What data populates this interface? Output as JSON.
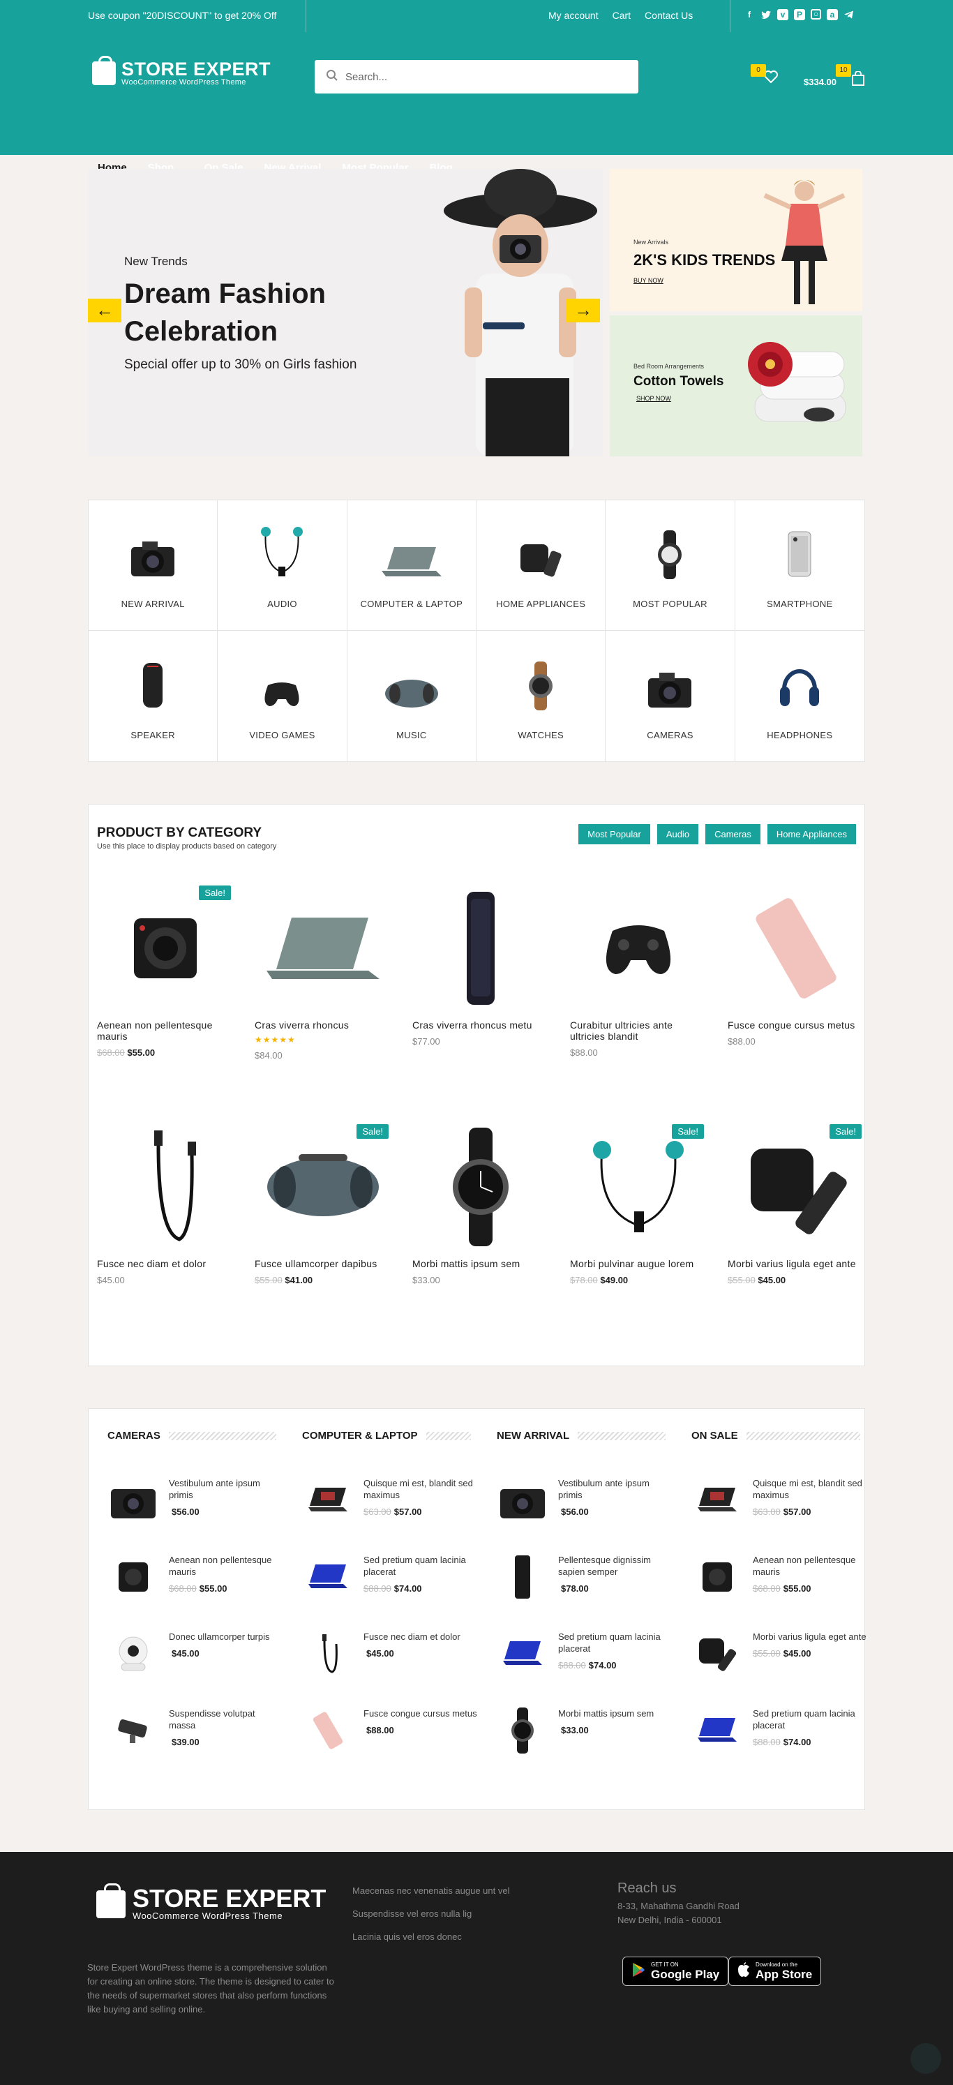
{
  "topbar": {
    "coupon": "Use coupon \"20DISCOUNT\" to get 20% Off",
    "links": [
      "My account",
      "Cart",
      "Contact Us"
    ],
    "socials": [
      "facebook-icon",
      "twitter-icon",
      "vimeo-icon",
      "paypal-icon",
      "instagram-icon",
      "amazon-icon",
      "telegram-icon"
    ]
  },
  "header": {
    "logo_name": "STORE EXPERT",
    "logo_sub": "WooCommerce WordPress Theme",
    "search_placeholder": "Search...",
    "wishlist_count": "0",
    "cart_count": "10",
    "cart_total": "$334.00"
  },
  "nav": [
    "Home",
    "Shop",
    "On Sale",
    "New Arrival",
    "Most Popular",
    "Blog"
  ],
  "hero": {
    "kicker": "New Trends",
    "title": "Dream Fashion Celebration",
    "offer": "Special offer up to 30% on Girls fashion"
  },
  "banner1": {
    "small": "New Arrivals",
    "big": "2K'S KIDS TRENDS",
    "link": "BUY NOW"
  },
  "banner2": {
    "small": "Bed Room Arrangements",
    "big": "Cotton Towels",
    "link": "SHOP NOW"
  },
  "categories": [
    "NEW ARRIVAL",
    "AUDIO",
    "COMPUTER & LAPTOP",
    "HOME APPLIANCES",
    "MOST POPULAR",
    "SMARTPHONE",
    "SPEAKER",
    "VIDEO GAMES",
    "MUSIC",
    "WATCHES",
    "CAMERAS",
    "HEADPHONES"
  ],
  "pbc": {
    "title": "PRODUCT BY CATEGORY",
    "subtitle": "Use this place to display products based on category",
    "tabs": [
      "Most Popular",
      "Audio",
      "Cameras",
      "Home Appliances"
    ],
    "sale_label": "Sale!",
    "products": [
      {
        "name": "Aenean non pellentesque mauris",
        "old": "$68.00",
        "price": "$55.00",
        "sale": true
      },
      {
        "name": "Cras viverra rhoncus",
        "old": "",
        "price": "$84.00",
        "sale": false,
        "stars": "★★★★★"
      },
      {
        "name": "Cras viverra rhoncus metu",
        "old": "",
        "price": "$77.00",
        "sale": false
      },
      {
        "name": "Curabitur ultricies ante ultricies blandit",
        "old": "",
        "price": "$88.00",
        "sale": false
      },
      {
        "name": "Fusce congue cursus metus",
        "old": "",
        "price": "$88.00",
        "sale": false
      },
      {
        "name": "Fusce nec diam et dolor",
        "old": "",
        "price": "$45.00",
        "sale": false
      },
      {
        "name": "Fusce ullamcorper dapibus",
        "old": "$55.00",
        "price": "$41.00",
        "sale": true
      },
      {
        "name": "Morbi mattis ipsum sem",
        "old": "",
        "price": "$33.00",
        "sale": false
      },
      {
        "name": "Morbi pulvinar augue lorem",
        "old": "$78.00",
        "price": "$49.00",
        "sale": true
      },
      {
        "name": "Morbi varius ligula eget ante",
        "old": "$55.00",
        "price": "$45.00",
        "sale": true
      }
    ]
  },
  "lists": [
    {
      "head": "CAMERAS",
      "items": [
        {
          "name": "Vestibulum ante ipsum primis",
          "old": "",
          "price": "$56.00"
        },
        {
          "name": "Aenean non pellentesque mauris",
          "old": "$68.00",
          "price": "$55.00"
        },
        {
          "name": "Donec ullamcorper turpis",
          "old": "",
          "price": "$45.00"
        },
        {
          "name": "Suspendisse volutpat massa",
          "old": "",
          "price": "$39.00"
        }
      ]
    },
    {
      "head": "COMPUTER & LAPTOP",
      "items": [
        {
          "name": "Quisque mi est, blandit sed maximus",
          "old": "$63.00",
          "price": "$57.00"
        },
        {
          "name": "Sed pretium quam lacinia placerat",
          "old": "$88.00",
          "price": "$74.00"
        },
        {
          "name": "Fusce nec diam et dolor",
          "old": "",
          "price": "$45.00"
        },
        {
          "name": "Fusce congue cursus metus",
          "old": "",
          "price": "$88.00"
        }
      ]
    },
    {
      "head": "NEW ARRIVAL",
      "items": [
        {
          "name": "Vestibulum ante ipsum primis",
          "old": "",
          "price": "$56.00"
        },
        {
          "name": "Pellentesque dignissim sapien semper",
          "old": "",
          "price": "$78.00"
        },
        {
          "name": "Sed pretium quam lacinia placerat",
          "old": "$88.00",
          "price": "$74.00"
        },
        {
          "name": "Morbi mattis ipsum sem",
          "old": "",
          "price": "$33.00"
        }
      ]
    },
    {
      "head": "ON SALE",
      "items": [
        {
          "name": "Quisque mi est, blandit sed maximus",
          "old": "$63.00",
          "price": "$57.00"
        },
        {
          "name": "Aenean non pellentesque mauris",
          "old": "$68.00",
          "price": "$55.00"
        },
        {
          "name": "Morbi varius ligula eget ante",
          "old": "$55.00",
          "price": "$45.00"
        },
        {
          "name": "Sed pretium quam lacinia placerat",
          "old": "$88.00",
          "price": "$74.00"
        }
      ]
    }
  ],
  "footer": {
    "logo_name": "STORE EXPERT",
    "logo_sub": "WooCommerce WordPress Theme",
    "desc": "Store Expert WordPress theme is a comprehensive solution for creating an online store. The theme is designed to cater to the needs of supermarket stores that also perform functions like buying and selling online.",
    "links": [
      "Maecenas nec venenatis augue unt vel",
      "Suspendisse vel eros nulla lig",
      "Lacinia quis vel eros donec"
    ],
    "reach_title": "Reach us",
    "address1": "8-33, Mahathma Gandhi Road",
    "address2": "New Delhi, India - 600001",
    "google_small": "GET IT ON",
    "google_big": "Google Play",
    "apple_small": "Download on the",
    "apple_big": "App Store"
  }
}
